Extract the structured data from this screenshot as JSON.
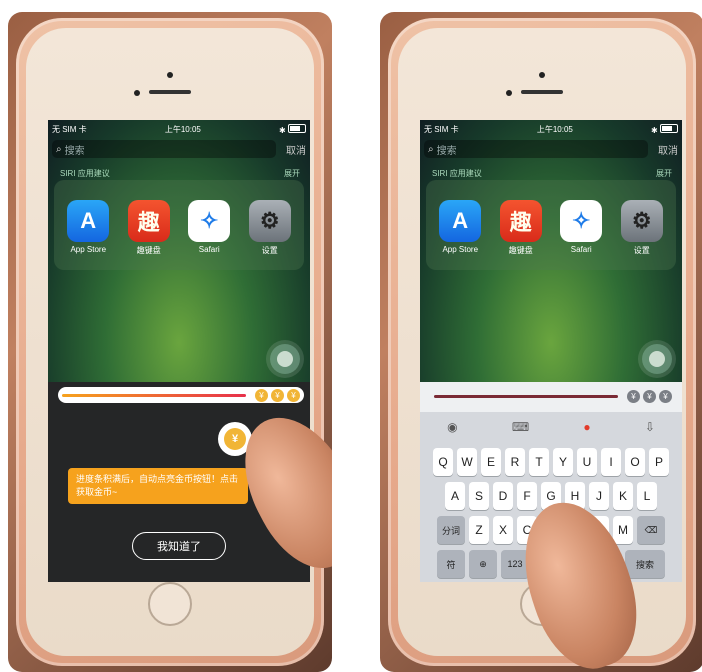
{
  "left": {
    "status": {
      "carrier": "无 SIM 卡 ",
      "time": "上午10:05",
      "bt": "✱"
    },
    "search": {
      "placeholder": "搜索",
      "cancel": "取消"
    },
    "siri": {
      "title": "SIRI 应用建议",
      "more": "展开"
    },
    "apps": [
      {
        "name": "App Store",
        "glyph": "A",
        "icon": "app-store-icon"
      },
      {
        "name": "趣键盘",
        "glyph": "趣",
        "icon": "qujianpan-icon"
      },
      {
        "name": "Safari",
        "glyph": "✧",
        "icon": "safari-icon"
      },
      {
        "name": "设置",
        "glyph": "⚙",
        "icon": "settings-icon"
      }
    ],
    "coin_glyph": "¥",
    "tooltip": "进度条积满后，自动点亮金币按钮！点击获取金币~",
    "got_it": "我知道了"
  },
  "right": {
    "status": {
      "carrier": "无 SIM 卡 ",
      "time": "上午10:05",
      "bt": "✱"
    },
    "search": {
      "placeholder": "搜索",
      "cancel": "取消"
    },
    "siri": {
      "title": "SIRI 应用建议",
      "more": "展开"
    },
    "apps": [
      {
        "name": "App Store",
        "glyph": "A",
        "icon": "app-store-icon"
      },
      {
        "name": "趣键盘",
        "glyph": "趣",
        "icon": "qujianpan-icon"
      },
      {
        "name": "Safari",
        "glyph": "✧",
        "icon": "safari-icon"
      },
      {
        "name": "设置",
        "glyph": "⚙",
        "icon": "settings-icon"
      }
    ],
    "coin_glyph": "¥",
    "keyboard": {
      "row1": [
        "Q",
        "W",
        "E",
        "R",
        "T",
        "Y",
        "U",
        "I",
        "O",
        "P"
      ],
      "row2": [
        "A",
        "S",
        "D",
        "F",
        "G",
        "H",
        "J",
        "K",
        "L"
      ],
      "row3": [
        "Z",
        "X",
        "C",
        "V",
        "B",
        "N",
        "M"
      ],
      "shift": "分词",
      "delete": "⌫",
      "symbols": "符",
      "globe": "⊕",
      "numbers": "123",
      "space": "",
      "return": "搜索"
    }
  },
  "colors": {
    "accent": "#f6a21d",
    "coin": "#f1b536"
  }
}
